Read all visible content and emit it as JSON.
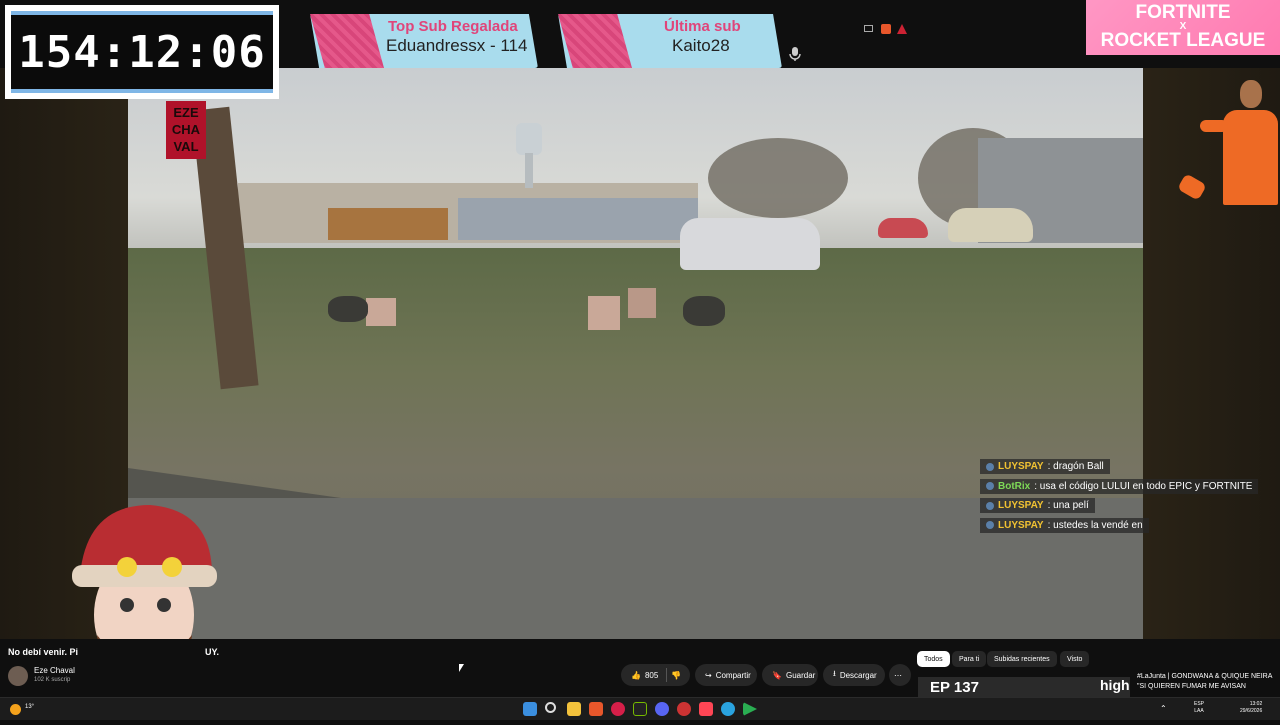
{
  "timer": {
    "value": "154:12:06"
  },
  "banners": [
    {
      "title": "Top Sub Regalada",
      "value": "Eduandressx - 114"
    },
    {
      "title": "Última sub",
      "value": "Kaito28"
    }
  ],
  "ad": {
    "line1": "FORTNITE",
    "x": "X",
    "line2": "ROCKET LEAGUE"
  },
  "logo": {
    "l1": "EZE",
    "l2": "CHA",
    "l3": "VAL"
  },
  "chat": [
    {
      "user": "LUYSPAY",
      "message": ": dragón Ball",
      "user_color": "#f1c232"
    },
    {
      "user": "BotRix",
      "message": ": usa el código LULUI en todo EPIC y FORTNITE",
      "user_color": "#7ed957"
    },
    {
      "user": "LUYSPAY",
      "message": ": una pelí",
      "user_color": "#f1c232"
    },
    {
      "user": "LUYSPAY",
      "message": ": ustedes la vendé en",
      "user_color": "#f1c232"
    }
  ],
  "video": {
    "title_partial_left": "No debí venir. Pi",
    "title_partial_right": "UY.",
    "channel": "Eze Chaval",
    "subs": "102 K suscrip",
    "likes": "805",
    "share_label": "Compartir",
    "save_label": "Guardar",
    "download_label": "Descargar"
  },
  "chips": [
    "Todos",
    "Para ti",
    "Subidas recientes",
    "Visto"
  ],
  "recommendation": {
    "thumb_text": "EP 137",
    "thumb_sub": "high",
    "title": "#LaJunta | GONDWANA & QUIQUE NEIRA \"SI QUIEREN FUMAR ME AVISAN"
  },
  "taskbar": {
    "lang_top": "ESP",
    "lang_bottom": "LAA",
    "time": "13:02",
    "date": "29/6/2026",
    "weather": "13°"
  },
  "icons": {
    "accent_blue": "#7fb6e6",
    "banner_bg": "#a9dced",
    "banner_title": "#e0457a"
  }
}
